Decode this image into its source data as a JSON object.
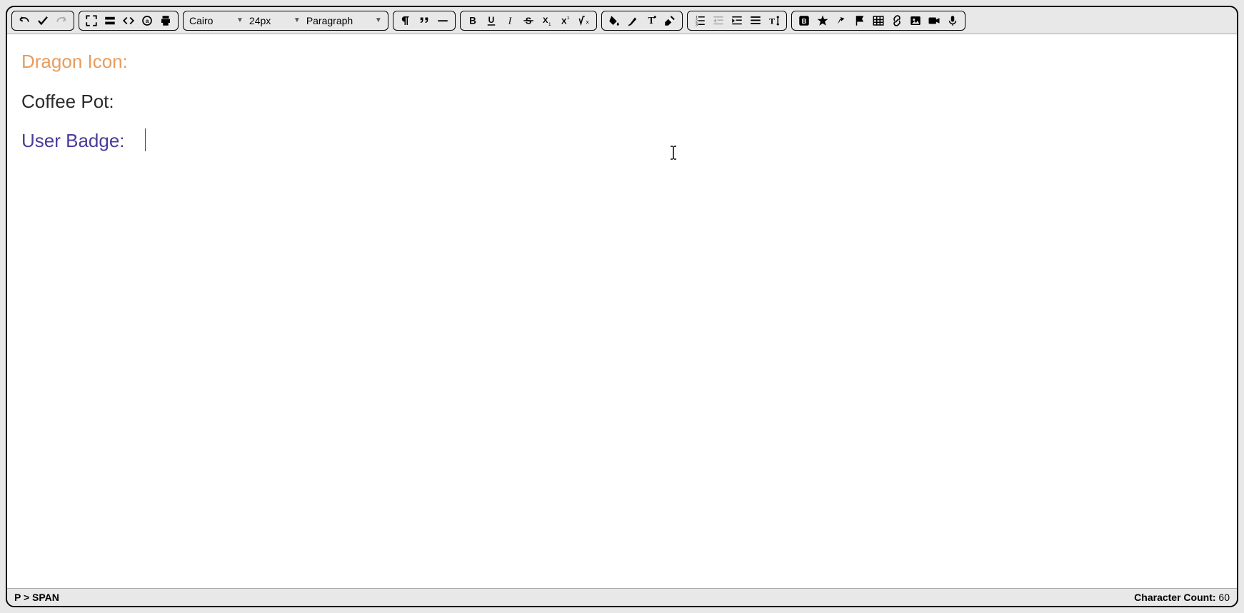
{
  "toolbar": {
    "fontFamily": "Cairo",
    "fontSize": "24px",
    "blockFormat": "Paragraph"
  },
  "content": {
    "line1": "Dragon Icon:",
    "line2": "Coffee Pot:",
    "line3": "User Badge:"
  },
  "statusBar": {
    "path": "P > SPAN",
    "charCountLabel": "Character Count:",
    "charCountValue": "60"
  },
  "icons": {
    "undo": "undo-icon",
    "check": "check-icon",
    "redo": "redo-icon",
    "fullscreen": "fullscreen-icon",
    "toolbar2": "toolbar-icon",
    "source": "source-icon",
    "preview": "preview-icon",
    "print": "print-icon",
    "pilcrow": "pilcrow-icon",
    "quote": "quote-icon",
    "hr": "hr-icon",
    "bold": "bold-icon",
    "underline": "underline-icon",
    "italic": "italic-icon",
    "strike": "strike-icon",
    "subscript": "subscript-icon",
    "superscript": "superscript-icon",
    "formula": "formula-icon",
    "fillcolor": "fillcolor-icon",
    "highlight": "highlight-icon",
    "textcolor": "textcolor-icon",
    "eraser": "eraser-icon",
    "ol": "ol-icon",
    "indentDec": "indent-dec-icon",
    "indentInc": "indent-inc-icon",
    "align": "align-icon",
    "lineheight": "lineheight-icon",
    "component": "component-icon",
    "star": "star-icon",
    "transform": "transform-icon",
    "flag": "flag-icon",
    "table": "table-icon",
    "link": "link-icon",
    "image": "image-icon",
    "video": "video-icon",
    "mic": "mic-icon"
  }
}
